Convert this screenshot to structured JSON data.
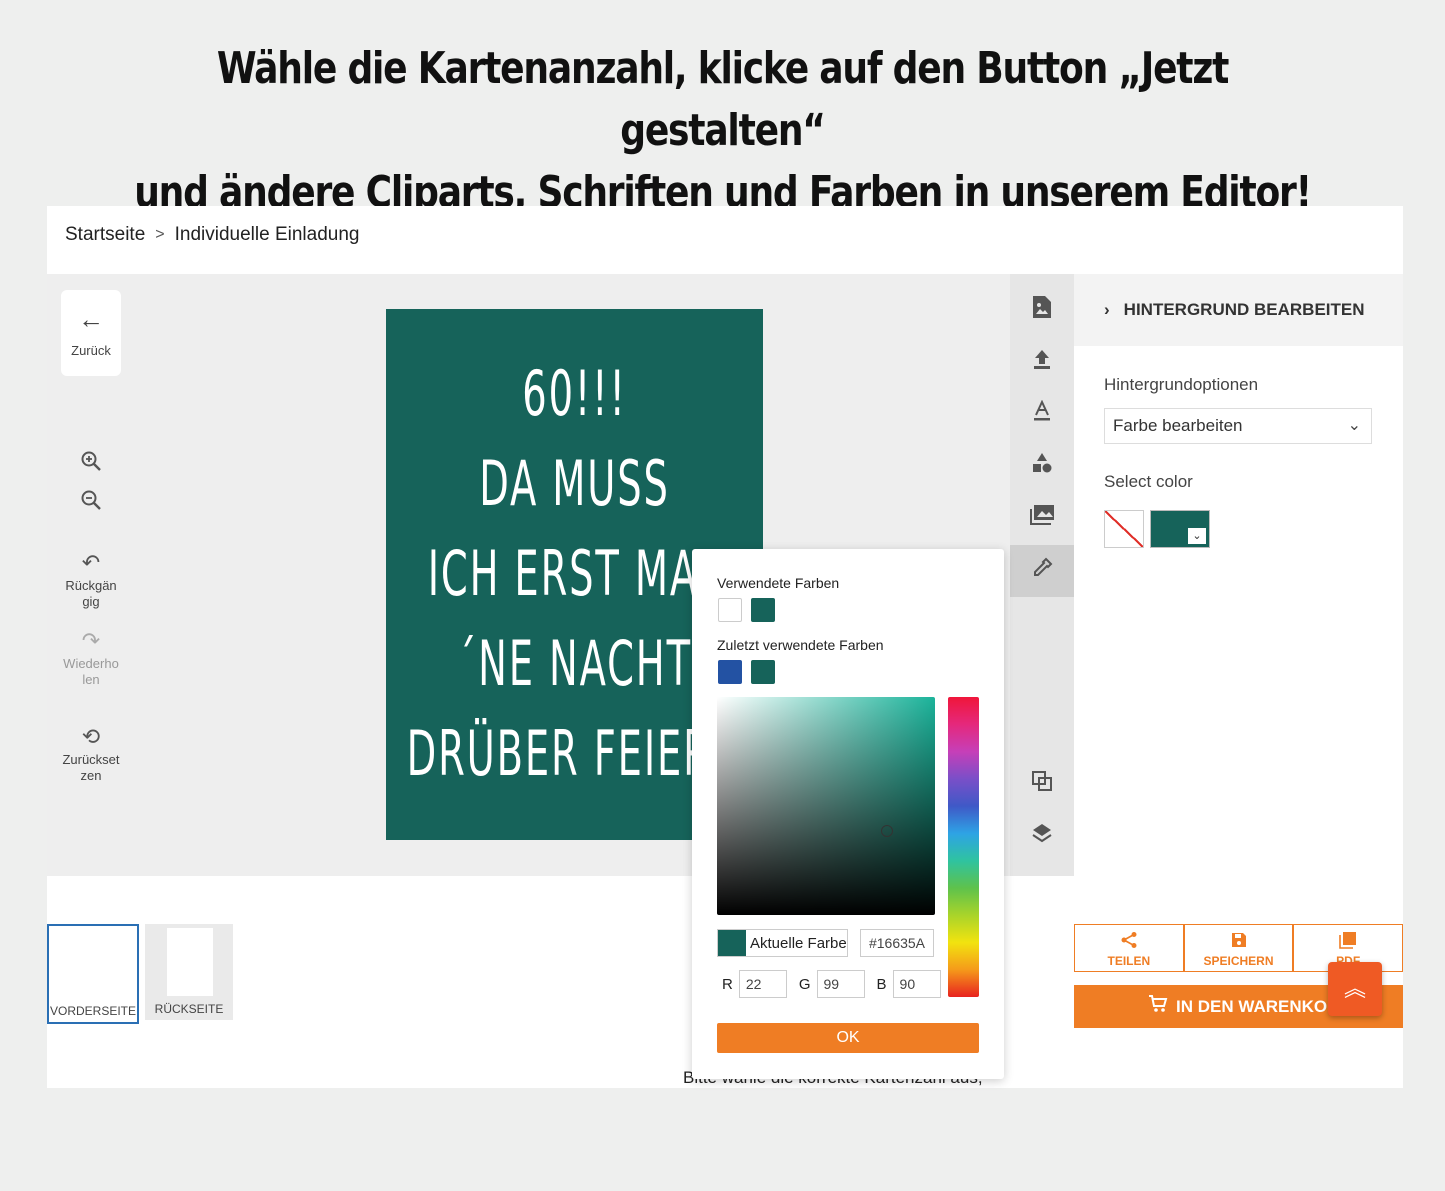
{
  "headline": {
    "line1": "Wähle die Kartenanzahl, klicke auf den Button „Jetzt gestalten“",
    "line2": "und ändere Cliparts, Schriften und Farben in unserem Editor!"
  },
  "breadcrumb": {
    "home": "Startseite",
    "separator": ">",
    "current": "Individuelle Einladung"
  },
  "left_tools": {
    "back": "Zurück",
    "undo": "Rückgängig",
    "redo": "Wiederholen",
    "reset": "Zurücksetzen"
  },
  "card": {
    "background": "#16635a",
    "lines": [
      "60!!!",
      "DA MUSS",
      "ICH ERST MAL",
      "´NE NACHT",
      "DRÜBER FEIERN"
    ]
  },
  "right_panel": {
    "title": "HINTERGRUND BEARBEITEN",
    "options_label": "Hintergrundoptionen",
    "select_value": "Farbe bearbeiten",
    "select_color_label": "Select color",
    "current_color": "#16635a"
  },
  "pages": {
    "front": "VORDERSEITE",
    "back": "RÜCKSEITE"
  },
  "actions": {
    "share": "TEILEN",
    "save": "SPEICHERN",
    "pdf": "PDF",
    "cart": "IN DEN WARENKORB"
  },
  "bottom_note": "Bitte wähle die korrekte Kartenzahl aus,",
  "color_picker": {
    "used_title": "Verwendete Farben",
    "used_colors": [
      "#ffffff",
      "#16635a"
    ],
    "recent_title": "Zuletzt verwendete Farben",
    "recent_colors": [
      "#2352a3",
      "#16635a"
    ],
    "current_label": "Aktuelle Farbe",
    "hex": "#16635A",
    "r_label": "R",
    "r": "22",
    "g_label": "G",
    "g": "99",
    "b_label": "B",
    "b": "90",
    "ok": "OK"
  }
}
